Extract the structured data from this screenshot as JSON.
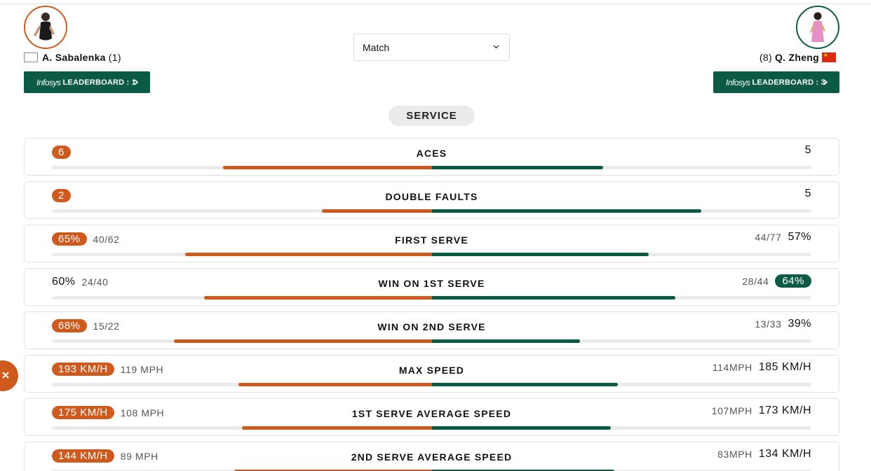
{
  "players": {
    "p1": {
      "name": "A. Sabalenka",
      "seed": "(1)",
      "leaderboard_brand": "Infosys",
      "leaderboard_label": "LEADERBOARD : 1"
    },
    "p2": {
      "name": "Q. Zheng",
      "seed": "(8)",
      "leaderboard_brand": "Infosys",
      "leaderboard_label": "LEADERBOARD : 3"
    }
  },
  "match_select": {
    "value": "Match"
  },
  "section": "SERVICE",
  "colors": {
    "player1": "#cf5a1e",
    "player2": "#0b5a45"
  },
  "stats": [
    {
      "title": "ACES",
      "left_main": "6",
      "left_sub": "",
      "right_main": "5",
      "right_sub": "",
      "left_badge": true,
      "right_badge": false,
      "left_bar": 0.55,
      "right_bar": 0.45
    },
    {
      "title": "DOUBLE FAULTS",
      "left_main": "2",
      "left_sub": "",
      "right_main": "5",
      "right_sub": "",
      "left_badge": true,
      "right_badge": false,
      "left_bar": 0.29,
      "right_bar": 0.71
    },
    {
      "title": "FIRST SERVE",
      "left_main": "65%",
      "left_sub": "40/62",
      "right_main": "57%",
      "right_sub": "44/77",
      "left_badge": true,
      "right_badge": false,
      "left_bar": 0.65,
      "right_bar": 0.57
    },
    {
      "title": "WIN ON 1ST SERVE",
      "left_main": "60%",
      "left_sub": "24/40",
      "right_main": "64%",
      "right_sub": "28/44",
      "left_badge": false,
      "right_badge": true,
      "left_bar": 0.6,
      "right_bar": 0.64
    },
    {
      "title": "WIN ON 2ND SERVE",
      "left_main": "68%",
      "left_sub": "15/22",
      "right_main": "39%",
      "right_sub": "13/33",
      "left_badge": true,
      "right_badge": false,
      "left_bar": 0.68,
      "right_bar": 0.39
    },
    {
      "title": "MAX SPEED",
      "left_main": "193 KM/H",
      "left_sub": "119 MPH",
      "right_main": "185 KM/H",
      "right_sub": "114MPH",
      "left_badge": true,
      "right_badge": false,
      "left_bar": 0.51,
      "right_bar": 0.49
    },
    {
      "title": "1ST SERVE AVERAGE SPEED",
      "left_main": "175 KM/H",
      "left_sub": "108 MPH",
      "right_main": "173 KM/H",
      "right_sub": "107MPH",
      "left_badge": true,
      "right_badge": false,
      "left_bar": 0.5,
      "right_bar": 0.47
    },
    {
      "title": "2ND SERVE AVERAGE SPEED",
      "left_main": "144 KM/H",
      "left_sub": "89 MPH",
      "right_main": "134 KM/H",
      "right_sub": "83MPH",
      "left_badge": true,
      "right_badge": false,
      "left_bar": 0.52,
      "right_bar": 0.48
    }
  ]
}
